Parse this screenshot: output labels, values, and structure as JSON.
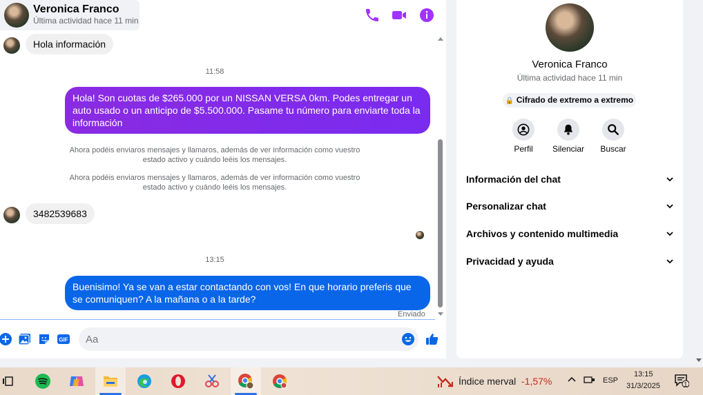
{
  "header": {
    "name": "Veronica Franco",
    "status": "Última actividad hace 11 min",
    "icons": [
      "phone-icon",
      "video-icon",
      "info-icon"
    ],
    "accent": "#a033ff"
  },
  "messages": {
    "in1": "Hola información",
    "time1": "11:58",
    "out1": "Hola! Son cuotas de $265.000 por un NISSAN VERSA 0km. Podes entregar un auto usado o un anticipo de $5.500.000. Pasame tu número para enviarte toda la información",
    "notice1": "Ahora podéis enviaros mensajes y llamaros, además de ver información como vuestro estado activo y cuándo leéis los mensajes.",
    "notice2": "Ahora podéis enviaros mensajes y llamaros, además de ver información como vuestro estado activo y cuándo leéis los mensajes.",
    "in2": "3482539683",
    "time2": "13:15",
    "out2": "Buenisimo! Ya se van a estar contactando con vos! En que horario preferis que se comuniquen? A la mañana o a la tarde?",
    "sent_status": "Enviado",
    "out1_color": "#8a2be2",
    "out2_color": "#0a66e8"
  },
  "composer": {
    "placeholder": "Aa",
    "icons": [
      "add-icon",
      "photo-icon",
      "sticker-icon",
      "gif-icon",
      "emoji-icon",
      "like-icon"
    ],
    "gif_label": "GIF"
  },
  "info": {
    "name": "Veronica Franco",
    "status": "Última actividad hace 11 min",
    "encryption": "Cifrado de extremo a extremo",
    "actions": [
      {
        "label": "Perfil",
        "icon": "profile-icon"
      },
      {
        "label": "Silenciar",
        "icon": "bell-icon"
      },
      {
        "label": "Buscar",
        "icon": "search-icon"
      }
    ],
    "sections": [
      "Información del chat",
      "Personalizar chat",
      "Archivos y contenido multimedia",
      "Privacidad y ayuda"
    ]
  },
  "taskbar": {
    "apps": [
      "task-view-icon",
      "spotify-icon",
      "copilot-icon",
      "file-explorer-icon",
      "edge-icon",
      "opera-icon",
      "snipping-icon",
      "chrome-profile-icon",
      "chrome-icon"
    ],
    "market_label": "Índice merval",
    "market_change": "-1,57%",
    "market_color": "#c42b1c",
    "language": "ESP",
    "time": "13:15",
    "date": "31/3/2025",
    "notifications": "1"
  }
}
